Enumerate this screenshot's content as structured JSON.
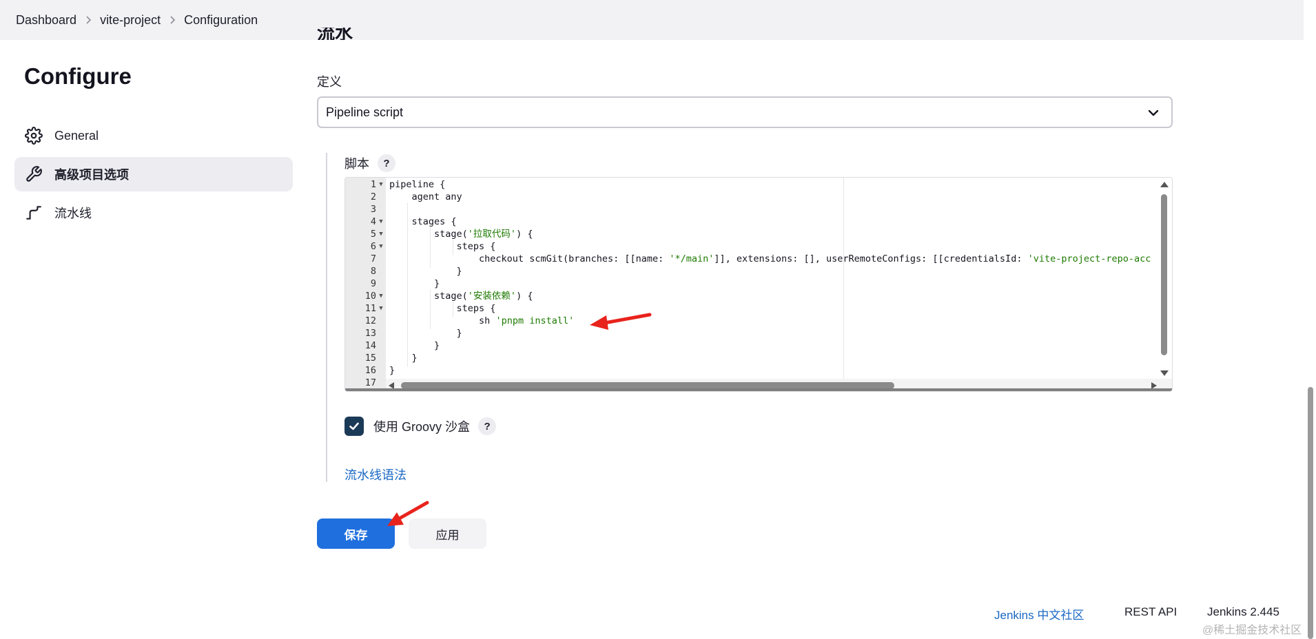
{
  "breadcrumb": {
    "items": [
      "Dashboard",
      "vite-project",
      "Configuration"
    ]
  },
  "sidebar": {
    "title": "Configure",
    "items": [
      {
        "label": "General",
        "icon": "gear-icon",
        "active": false
      },
      {
        "label": "高级项目选项",
        "icon": "wrench-icon",
        "active": true
      },
      {
        "label": "流水线",
        "icon": "pipeline-icon",
        "active": false
      }
    ]
  },
  "main": {
    "cut_heading": "流水线",
    "definition_label": "定义",
    "definition_value": "Pipeline script",
    "script_label": "脚本",
    "help_mark": "?",
    "code": [
      {
        "n": "1",
        "fold": "▼",
        "parts": [
          {
            "t": "pipeline {"
          }
        ]
      },
      {
        "n": "2",
        "fold": "",
        "parts": [
          {
            "t": "    agent any"
          }
        ]
      },
      {
        "n": "3",
        "fold": "",
        "parts": [
          {
            "t": ""
          }
        ]
      },
      {
        "n": "4",
        "fold": "▼",
        "parts": [
          {
            "t": "    stages {"
          }
        ]
      },
      {
        "n": "5",
        "fold": "▼",
        "parts": [
          {
            "t": "        stage("
          },
          {
            "t": "'拉取代码'",
            "s": 1
          },
          {
            "t": ") {"
          }
        ]
      },
      {
        "n": "6",
        "fold": "▼",
        "parts": [
          {
            "t": "            steps {"
          }
        ]
      },
      {
        "n": "7",
        "fold": "",
        "parts": [
          {
            "t": "                checkout scmGit(branches: [[name: "
          },
          {
            "t": "'*/main'",
            "s": 1
          },
          {
            "t": "]], extensions: [], userRemoteConfigs: [[credentialsId: "
          },
          {
            "t": "'vite-project-repo-acc",
            "s": 1
          }
        ]
      },
      {
        "n": "8",
        "fold": "",
        "parts": [
          {
            "t": "            }"
          }
        ]
      },
      {
        "n": "9",
        "fold": "",
        "parts": [
          {
            "t": "        }"
          }
        ]
      },
      {
        "n": "10",
        "fold": "▼",
        "parts": [
          {
            "t": "        stage("
          },
          {
            "t": "'安装依赖'",
            "s": 1
          },
          {
            "t": ") {"
          }
        ]
      },
      {
        "n": "11",
        "fold": "▼",
        "parts": [
          {
            "t": "            steps {"
          }
        ]
      },
      {
        "n": "12",
        "fold": "",
        "parts": [
          {
            "t": "                sh "
          },
          {
            "t": "'pnpm install'",
            "s": 1
          }
        ]
      },
      {
        "n": "13",
        "fold": "",
        "parts": [
          {
            "t": "            }"
          }
        ]
      },
      {
        "n": "14",
        "fold": "",
        "parts": [
          {
            "t": "        }"
          }
        ]
      },
      {
        "n": "15",
        "fold": "",
        "parts": [
          {
            "t": "    }"
          }
        ]
      },
      {
        "n": "16",
        "fold": "",
        "parts": [
          {
            "t": "}"
          }
        ]
      },
      {
        "n": "17",
        "fold": "",
        "parts": [
          {
            "t": ""
          }
        ]
      }
    ],
    "sandbox_label": "使用 Groovy 沙盒",
    "sandbox_checked": true,
    "syntax_link": "流水线语法"
  },
  "buttons": {
    "save": "保存",
    "apply": "应用"
  },
  "footer": {
    "community": "Jenkins 中文社区",
    "rest_api": "REST API",
    "version": "Jenkins 2.445"
  },
  "watermark": "@稀土掘金技术社区",
  "colors": {
    "primary": "#1f6fde",
    "link": "#1a68c4",
    "annotation": "#e8231c",
    "checkbox": "#1b3a57",
    "string": "#1d7a00"
  }
}
